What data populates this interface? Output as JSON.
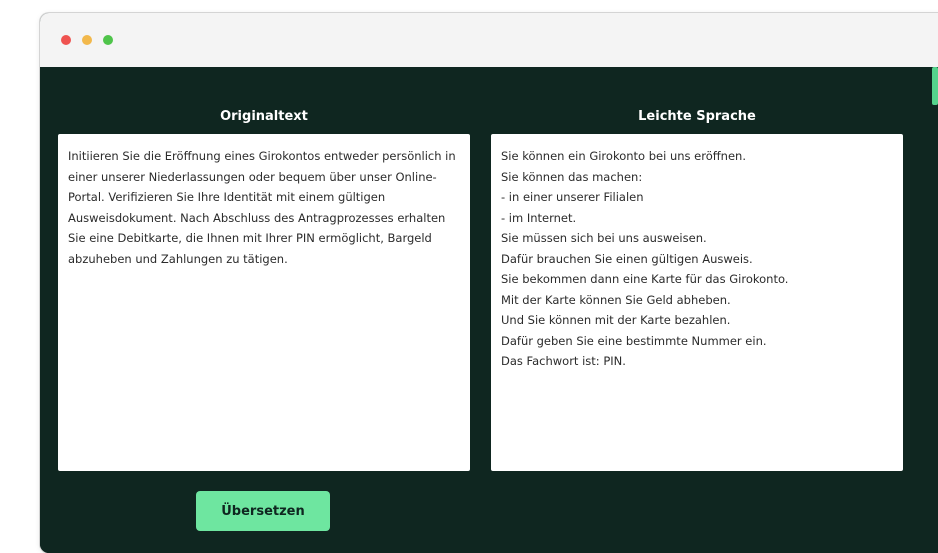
{
  "window": {
    "controls": [
      "close",
      "minimize",
      "maximize"
    ]
  },
  "colors": {
    "background": "#0f2620",
    "accent": "#6ee6a0",
    "dot_red": "#ef5350",
    "dot_yellow": "#f2b84b",
    "dot_green": "#4fc44a"
  },
  "original": {
    "title": "Originaltext",
    "text": "Initiieren Sie die Eröffnung eines Girokontos entweder persönlich in einer unserer Niederlassungen oder bequem über unser Online-Portal. Verifizieren Sie Ihre Identität mit einem gültigen Ausweisdokument. Nach Abschluss des Antragprozesses erhalten Sie eine Debitkarte, die Ihnen mit Ihrer PIN ermöglicht, Bargeld abzuheben und Zahlungen zu tätigen."
  },
  "simple": {
    "title": "Leichte Sprache",
    "lines": [
      "Sie können ein Girokonto bei uns eröffnen.",
      "Sie können das machen:",
      "- in einer unserer Filialen",
      "- im Internet.",
      "Sie müssen sich bei uns ausweisen.",
      "Dafür brauchen Sie einen gültigen Ausweis.",
      "Sie bekommen dann eine Karte für das Girokonto.",
      "Mit der Karte können Sie Geld abheben.",
      "Und Sie können mit der Karte bezahlen.",
      "Dafür geben Sie eine bestimmte Nummer ein.",
      "Das Fachwort ist: PIN."
    ]
  },
  "actions": {
    "translate_label": "Übersetzen"
  }
}
